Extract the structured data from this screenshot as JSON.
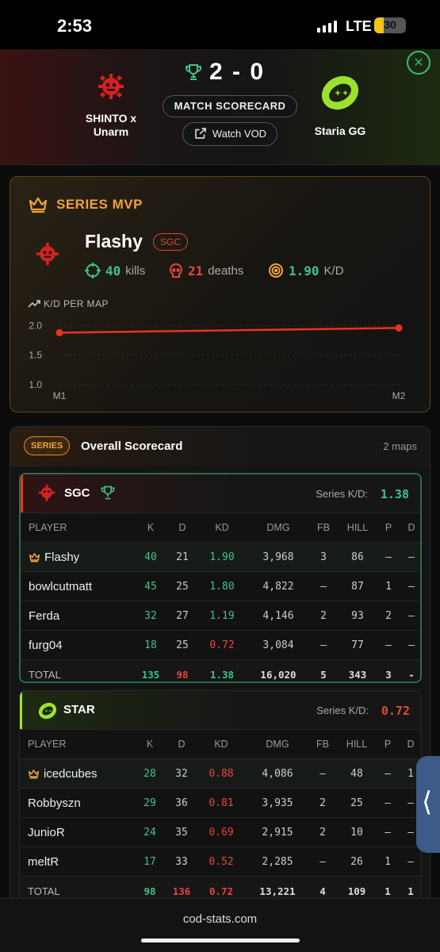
{
  "status_bar": {
    "time": "2:53",
    "network": "LTE",
    "battery": "30",
    "battery_level": 0.3
  },
  "match": {
    "team_left": "SHINTO x Unarm",
    "team_right": "Staria GG",
    "score": "2 - 0",
    "scorecard_label": "MATCH SCORECARD",
    "vod_label": "Watch VOD",
    "close_icon": "×"
  },
  "mvp": {
    "title": "SERIES MVP",
    "player": "Flashy",
    "team_tag": "SGC",
    "kills_value": "40",
    "kills_label": "kills",
    "deaths_value": "21",
    "deaths_label": "deaths",
    "kd_value": "1.90",
    "kd_label": "K/D",
    "chart_title": "K/D PER MAP"
  },
  "chart_data": {
    "type": "line",
    "title": "K/D PER MAP",
    "x": [
      "M1",
      "M2"
    ],
    "series": [
      {
        "values": [
          1.88,
          1.96
        ]
      }
    ],
    "yticks": [
      "2.0",
      "1.5",
      "1.0"
    ],
    "ylim": [
      1.0,
      2.1
    ],
    "color": "#e8341c",
    "grid": true
  },
  "overall": {
    "badge": "SERIES",
    "title": "Overall Scorecard",
    "maps": "2 maps"
  },
  "columns": [
    "PLAYER",
    "K",
    "D",
    "KD",
    "DMG",
    "FB",
    "HILL",
    "P",
    "D"
  ],
  "teams": [
    {
      "name": "SGC",
      "series_kd_label": "Series K/D:",
      "series_kd": "1.38",
      "accent": "#e8341c",
      "rows": [
        {
          "player": "Flashy",
          "k": "40",
          "d": "21",
          "kd": "1.90",
          "dmg": "3,968",
          "fb": "3",
          "hill": "86",
          "p": "–",
          "dd": "–"
        },
        {
          "player": "bowlcutmatt",
          "k": "45",
          "d": "25",
          "kd": "1.80",
          "dmg": "4,822",
          "fb": "–",
          "hill": "87",
          "p": "1",
          "dd": "–"
        },
        {
          "player": "Ferda",
          "k": "32",
          "d": "27",
          "kd": "1.19",
          "dmg": "4,146",
          "fb": "2",
          "hill": "93",
          "p": "2",
          "dd": "–"
        },
        {
          "player": "furg04",
          "k": "18",
          "d": "25",
          "kd": "0.72",
          "dmg": "3,084",
          "fb": "–",
          "hill": "77",
          "p": "–",
          "dd": "–"
        }
      ],
      "total": {
        "player": "TOTAL",
        "k": "135",
        "d": "98",
        "kd": "1.38",
        "dmg": "16,020",
        "fb": "5",
        "hill": "343",
        "p": "3",
        "dd": "-"
      }
    },
    {
      "name": "STAR",
      "series_kd_label": "Series K/D:",
      "series_kd": "0.72",
      "accent": "#9be22d",
      "rows": [
        {
          "player": "icedcubes",
          "k": "28",
          "d": "32",
          "kd": "0.88",
          "dmg": "4,086",
          "fb": "–",
          "hill": "48",
          "p": "–",
          "dd": "1"
        },
        {
          "player": "Robbyszn",
          "k": "29",
          "d": "36",
          "kd": "0.81",
          "dmg": "3,935",
          "fb": "2",
          "hill": "25",
          "p": "–",
          "dd": "–"
        },
        {
          "player": "JunioR",
          "k": "24",
          "d": "35",
          "kd": "0.69",
          "dmg": "2,915",
          "fb": "2",
          "hill": "10",
          "p": "–",
          "dd": "–"
        },
        {
          "player": "meltR",
          "k": "17",
          "d": "33",
          "kd": "0.52",
          "dmg": "2,285",
          "fb": "–",
          "hill": "26",
          "p": "1",
          "dd": "–"
        }
      ],
      "total": {
        "player": "TOTAL",
        "k": "98",
        "d": "136",
        "kd": "0.72",
        "dmg": "13,221",
        "fb": "4",
        "hill": "109",
        "p": "1",
        "dd": "1"
      }
    }
  ],
  "footer": {
    "url": "cod-stats.com"
  },
  "colors": {
    "green": "#3ec48a",
    "red": "#e2473f",
    "gold": "#f2a23a",
    "lime": "#9be22d"
  }
}
